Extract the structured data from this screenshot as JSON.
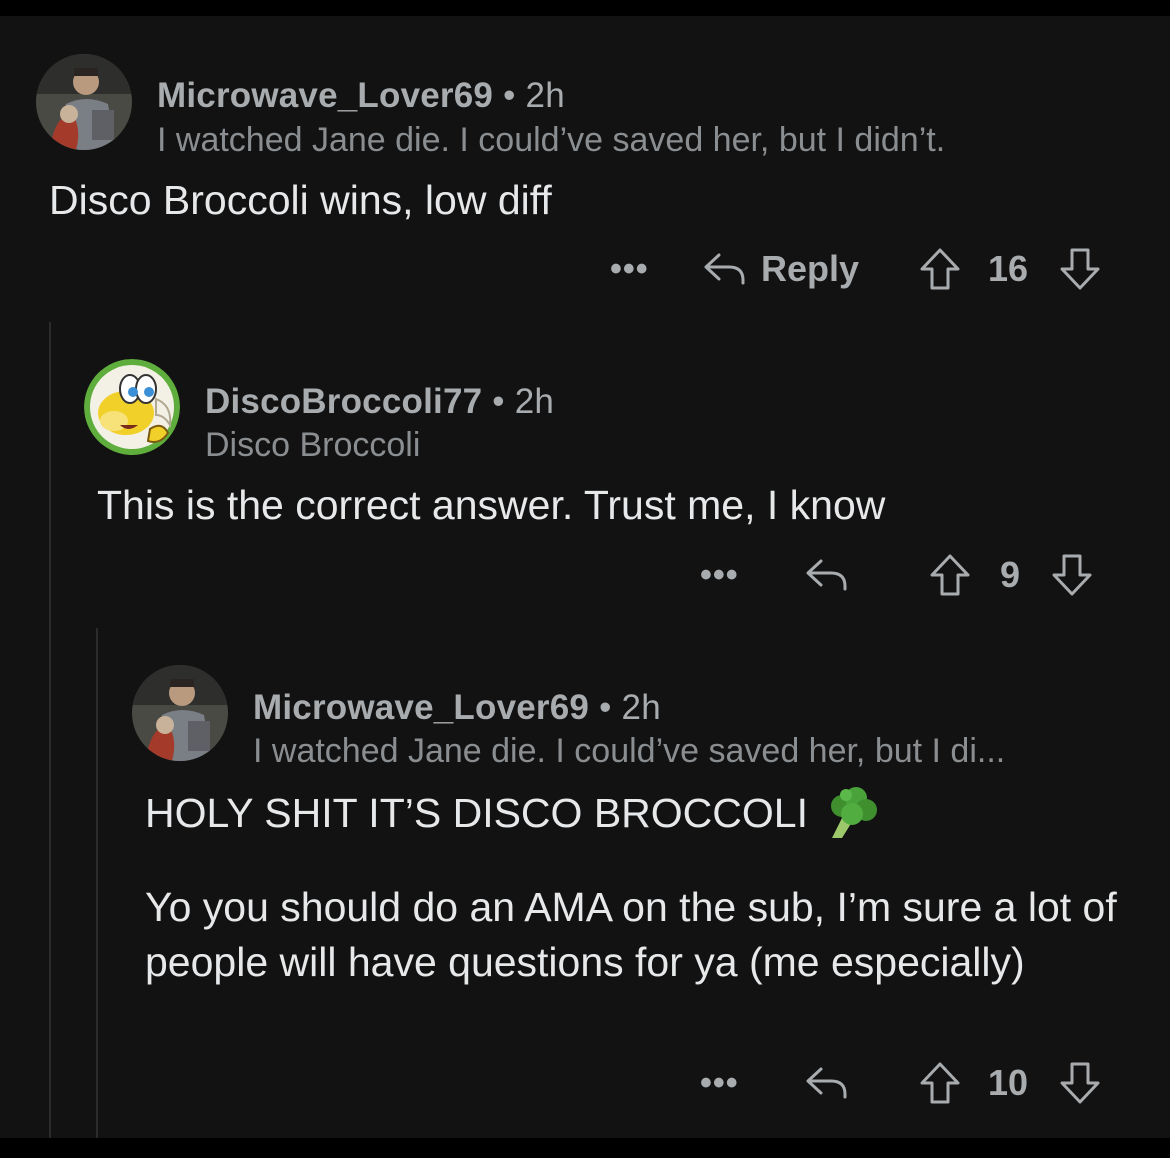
{
  "comments": [
    {
      "username": "Microwave_Lover69",
      "separator": "•",
      "time": "2h",
      "flair": "I watched Jane die. I could’ve saved her, but I didn’t.",
      "body": "Disco Broccoli wins, low diff",
      "reply_label": "Reply",
      "score": "16",
      "avatar_icon": "masked-figure-avatar"
    },
    {
      "username": "DiscoBroccoli77",
      "separator": "•",
      "time": "2h",
      "flair": "Disco Broccoli",
      "body": "This is the correct answer. Trust me, I know",
      "score": "9",
      "avatar_icon": "koopa-avatar"
    },
    {
      "username": "Microwave_Lover69",
      "separator": "•",
      "time": "2h",
      "flair": "I watched Jane die. I could’ve saved her, but I di...",
      "body_line1": "HOLY SHIT IT’S DISCO BROCCOLI",
      "body_emoji": "broccoli-emoji",
      "body_para2": "Yo you should do an AMA on the sub, I’m sure a lot of people will have questions for ya (me especially)",
      "score": "10",
      "avatar_icon": "masked-figure-avatar"
    }
  ],
  "more_label": "•••",
  "colors": {
    "background": "#121212",
    "text": "#e6e8ea",
    "meta": "#a9acaf",
    "thread_line": "#2b2b2b"
  }
}
